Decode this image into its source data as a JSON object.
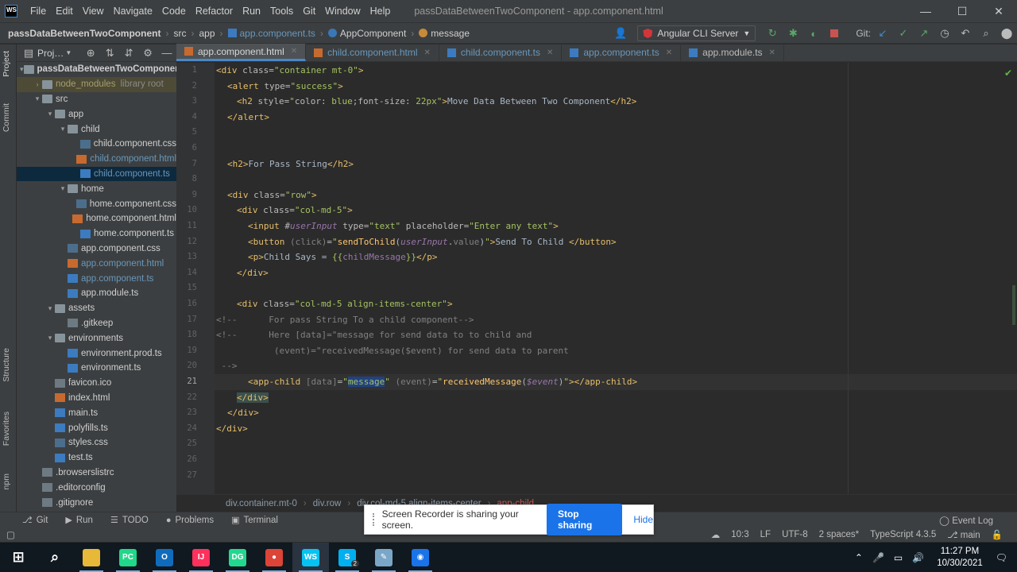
{
  "window": {
    "logo": "WS",
    "title": "passDataBetweenTwoComponent - app.component.html",
    "menu": [
      "File",
      "Edit",
      "View",
      "Navigate",
      "Code",
      "Refactor",
      "Run",
      "Tools",
      "Git",
      "Window",
      "Help"
    ],
    "controls": {
      "minimize": "—",
      "maximize": "☐",
      "close": "✕"
    }
  },
  "navbar": {
    "crumbs": [
      "passDataBetweenTwoComponent",
      "src",
      "app",
      "app.component.ts",
      "AppComponent",
      "message"
    ],
    "run_config": "Angular CLI Server",
    "git_label": "Git:"
  },
  "project_panel": {
    "title": "Proj…",
    "tree": [
      {
        "label": "passDataBetweenTwoComponent",
        "depth": 0,
        "arrow": "▾",
        "icon": "folder",
        "style": "bold"
      },
      {
        "label": "node_modules",
        "extra": "library root",
        "depth": 1,
        "arrow": "›",
        "icon": "folder",
        "style": "dim"
      },
      {
        "label": "src",
        "depth": 1,
        "arrow": "▾",
        "icon": "folder"
      },
      {
        "label": "app",
        "depth": 2,
        "arrow": "▾",
        "icon": "folder"
      },
      {
        "label": "child",
        "depth": 3,
        "arrow": "▾",
        "icon": "folder"
      },
      {
        "label": "child.component.css",
        "depth": 4,
        "icon": "css"
      },
      {
        "label": "child.component.html",
        "depth": 4,
        "icon": "html",
        "style": "blue"
      },
      {
        "label": "child.component.ts",
        "depth": 4,
        "icon": "ts",
        "style": "blue-selected"
      },
      {
        "label": "home",
        "depth": 3,
        "arrow": "▾",
        "icon": "folder"
      },
      {
        "label": "home.component.css",
        "depth": 4,
        "icon": "css"
      },
      {
        "label": "home.component.html",
        "depth": 4,
        "icon": "html"
      },
      {
        "label": "home.component.ts",
        "depth": 4,
        "icon": "ts"
      },
      {
        "label": "app.component.css",
        "depth": 3,
        "icon": "css"
      },
      {
        "label": "app.component.html",
        "depth": 3,
        "icon": "html",
        "style": "blue"
      },
      {
        "label": "app.component.ts",
        "depth": 3,
        "icon": "ts",
        "style": "blue"
      },
      {
        "label": "app.module.ts",
        "depth": 3,
        "icon": "ts"
      },
      {
        "label": "assets",
        "depth": 2,
        "arrow": "▾",
        "icon": "folder"
      },
      {
        "label": ".gitkeep",
        "depth": 3,
        "icon": "gen"
      },
      {
        "label": "environments",
        "depth": 2,
        "arrow": "▾",
        "icon": "folder"
      },
      {
        "label": "environment.prod.ts",
        "depth": 3,
        "icon": "ts"
      },
      {
        "label": "environment.ts",
        "depth": 3,
        "icon": "ts"
      },
      {
        "label": "favicon.ico",
        "depth": 2,
        "icon": "gen"
      },
      {
        "label": "index.html",
        "depth": 2,
        "icon": "html"
      },
      {
        "label": "main.ts",
        "depth": 2,
        "icon": "ts"
      },
      {
        "label": "polyfills.ts",
        "depth": 2,
        "icon": "ts"
      },
      {
        "label": "styles.css",
        "depth": 2,
        "icon": "css"
      },
      {
        "label": "test.ts",
        "depth": 2,
        "icon": "ts"
      },
      {
        "label": ".browserslistrc",
        "depth": 1,
        "icon": "gen"
      },
      {
        "label": ".editorconfig",
        "depth": 1,
        "icon": "gen"
      },
      {
        "label": ".gitignore",
        "depth": 1,
        "icon": "gen"
      }
    ]
  },
  "side_tabs": {
    "project": "Project",
    "commit": "Commit",
    "structure": "Structure",
    "favorites": "Favorites",
    "npm": "npm"
  },
  "tabs": [
    {
      "label": "app.component.html",
      "icon": "html",
      "active": true
    },
    {
      "label": "child.component.html",
      "icon": "html",
      "modified": true
    },
    {
      "label": "child.component.ts",
      "icon": "ts",
      "modified": true
    },
    {
      "label": "app.component.ts",
      "icon": "ts",
      "modified": true
    },
    {
      "label": "app.module.ts",
      "icon": "ts"
    }
  ],
  "editor": {
    "active_line": 21,
    "line_numbers": [
      "1",
      "2",
      "3",
      "4",
      "5",
      "6",
      "7",
      "8",
      "9",
      "10",
      "11",
      "12",
      "13",
      "14",
      "15",
      "16",
      "17",
      "18",
      "19",
      "20",
      "21",
      "22",
      "23",
      "24",
      "25",
      "26",
      "27"
    ]
  },
  "editor_breadcrumb": [
    "div.container.mt-0",
    "div.row",
    "div.col-md-5.align-items-center",
    "app-child"
  ],
  "bottom_tools": [
    {
      "icon": "⎇",
      "label": "Git"
    },
    {
      "icon": "▶",
      "label": "Run"
    },
    {
      "icon": "☰",
      "label": "TODO"
    },
    {
      "icon": "●",
      "label": "Problems"
    },
    {
      "icon": "▣",
      "label": "Terminal"
    }
  ],
  "event_log": "Event Log",
  "status": {
    "position": "10:3",
    "line_sep": "LF",
    "encoding": "UTF-8",
    "indent": "2 spaces*",
    "language": "TypeScript 4.3.5",
    "branch": "main"
  },
  "share_banner": {
    "text": "Screen Recorder is sharing your screen.",
    "stop": "Stop sharing",
    "hide": "Hide"
  },
  "taskbar": {
    "apps": [
      {
        "name": "windows-start",
        "glyph": "⊞",
        "color": "#101820"
      },
      {
        "name": "search",
        "glyph": "⌕",
        "color": "#101820"
      },
      {
        "name": "file-explorer",
        "glyph": "",
        "color": "#e8b838"
      },
      {
        "name": "pycharm",
        "glyph": "PC",
        "color": "#21d789"
      },
      {
        "name": "outlook",
        "glyph": "O",
        "color": "#0f6cbd"
      },
      {
        "name": "intellij",
        "glyph": "IJ",
        "color": "#fe315d"
      },
      {
        "name": "datagrip",
        "glyph": "DG",
        "color": "#22d88f"
      },
      {
        "name": "chrome",
        "glyph": "●",
        "color": "#db4437"
      },
      {
        "name": "webstorm",
        "glyph": "WS",
        "color": "#07c3f2"
      },
      {
        "name": "skype",
        "glyph": "S",
        "color": "#00aff0"
      },
      {
        "name": "notepad",
        "glyph": "✎",
        "color": "#7aa7c7"
      },
      {
        "name": "screen-recorder",
        "glyph": "◉",
        "color": "#1a73e8"
      }
    ],
    "skype_badge": "2",
    "time": "11:27 PM",
    "date": "10/30/2021"
  }
}
